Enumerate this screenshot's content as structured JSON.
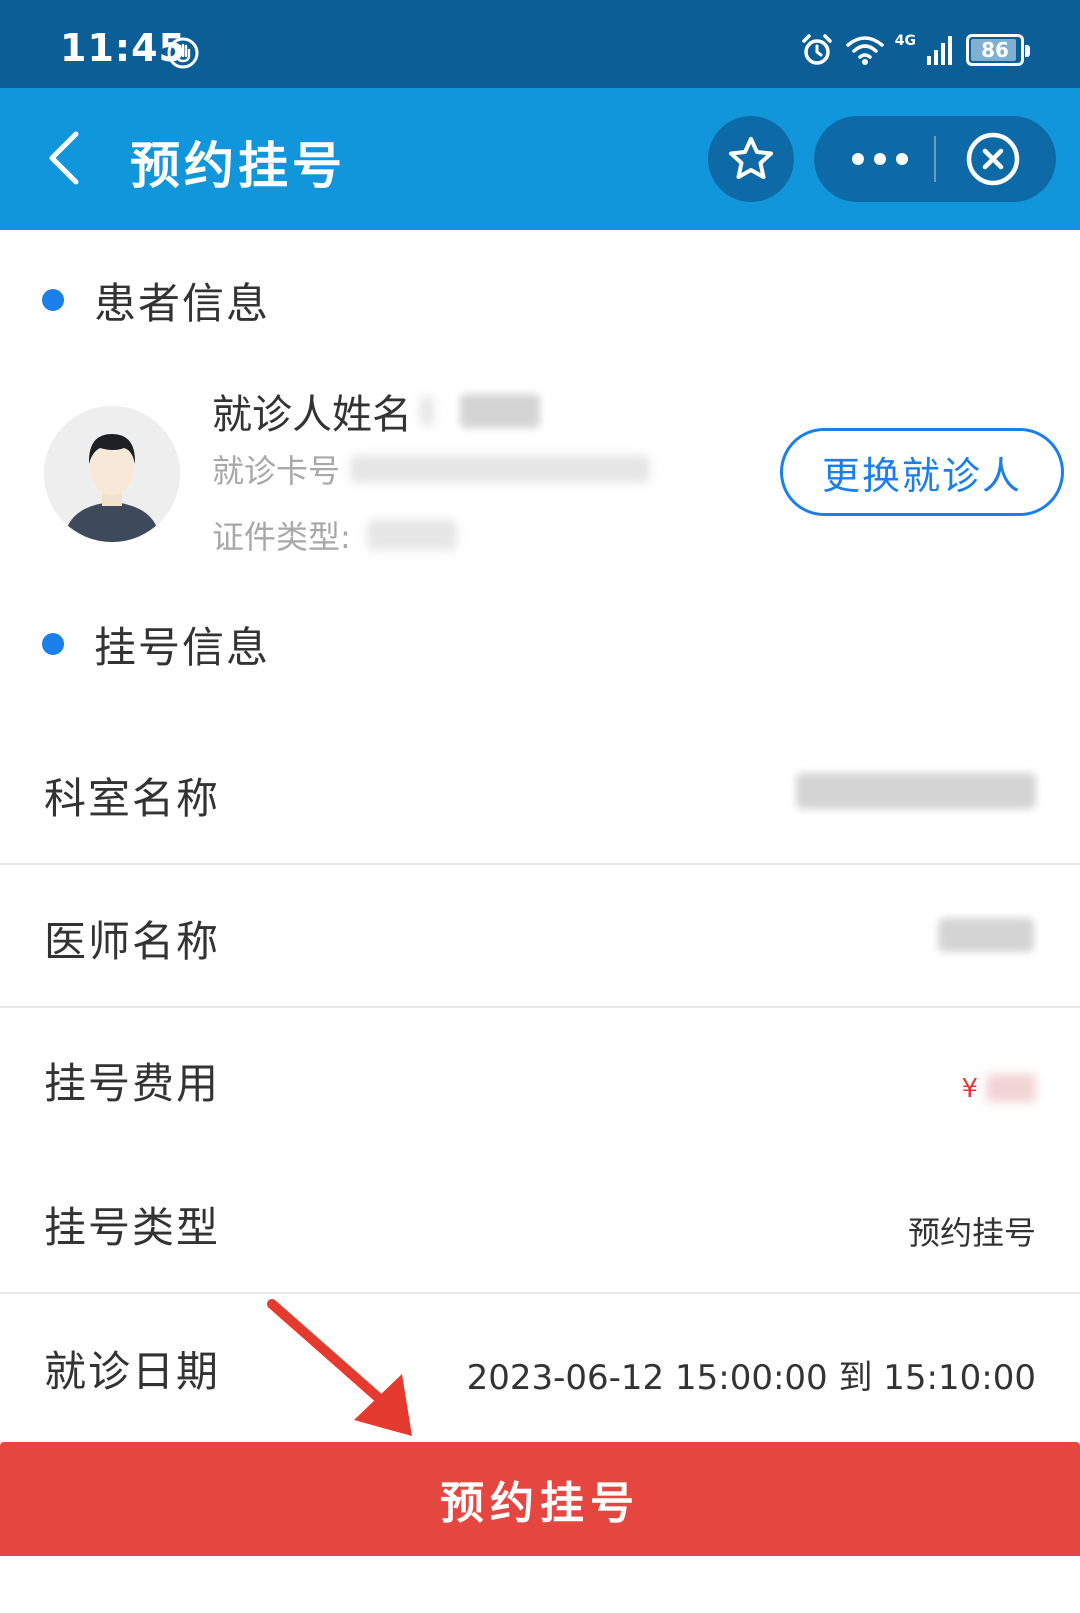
{
  "status_bar": {
    "time": "11:45",
    "network": "4G",
    "battery": "86",
    "battery_fraction": 0.86
  },
  "nav": {
    "title": "预约挂号",
    "icons": [
      "back-icon",
      "star-icon",
      "more-icon",
      "close-icon"
    ]
  },
  "patient_section": {
    "title": "患者信息",
    "name_label": "就诊人姓名",
    "card_label": "就诊卡号",
    "id_type_label": "证件类型:",
    "switch_button": "更换就诊人"
  },
  "registration_section": {
    "title": "挂号信息",
    "rows": [
      {
        "label": "科室名称",
        "value": ""
      },
      {
        "label": "医师名称",
        "value": ""
      },
      {
        "label": "挂号费用",
        "value": "¥"
      },
      {
        "label": "挂号类型",
        "value": "预约挂号"
      },
      {
        "label": "就诊日期",
        "value": "2023-06-12 15:00:00 到 15:10:00"
      }
    ]
  },
  "submit_button": "预约挂号",
  "colors": {
    "status_bar": "#0c5f96",
    "nav_bar": "#1296db",
    "accent_blue": "#1a7fe8",
    "submit_red": "#e5463f",
    "annotation_arrow": "#e53b2f"
  }
}
